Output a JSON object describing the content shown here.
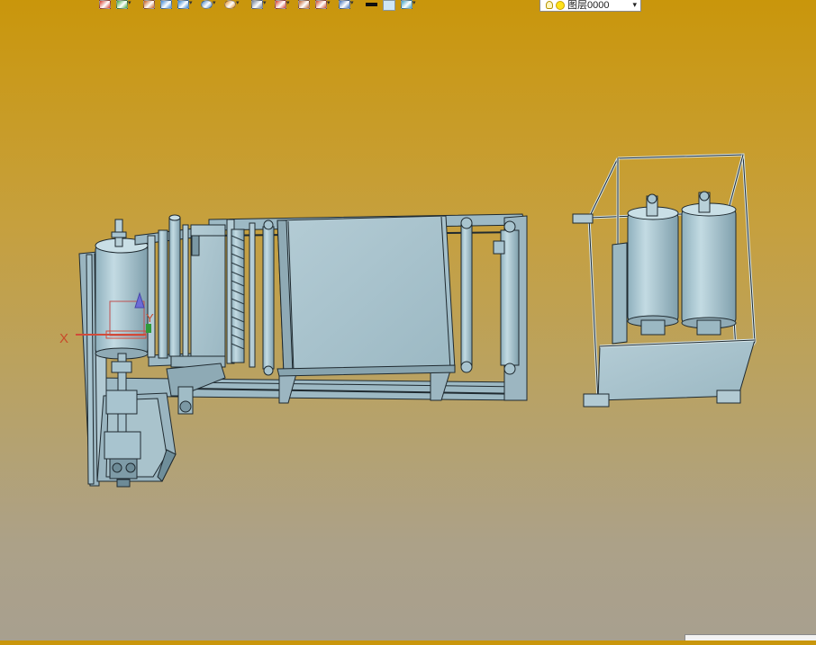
{
  "toolbar": {
    "buttons": [
      {
        "icon": "import-icon",
        "color": "#d63b2a",
        "dropdown": false
      },
      {
        "icon": "tree-icon",
        "color": "#3fa63a",
        "dropdown": true
      },
      {
        "icon": "pencil-icon",
        "color": "#c85a1a",
        "dropdown": false
      },
      {
        "icon": "layers-icon",
        "color": "#3c87d6",
        "dropdown": false
      },
      {
        "icon": "cube-icon",
        "color": "#2a7fd0",
        "dropdown": true
      },
      {
        "icon": "sphere-icon",
        "color": "#3c7fc4",
        "dropdown": true
      },
      {
        "icon": "wheel-icon",
        "color": "#e08a1c",
        "dropdown": true
      },
      {
        "icon": "sheet-icon",
        "color": "#6e7f9a",
        "dropdown": true
      },
      {
        "icon": "crosshair-icon",
        "color": "#d63b2a",
        "dropdown": true
      },
      {
        "icon": "frame-icon",
        "color": "#c0602a",
        "dropdown": false
      },
      {
        "icon": "box-select-icon",
        "color": "#d04a2a",
        "dropdown": true
      },
      {
        "icon": "display-icon",
        "color": "#3e6fb8",
        "dropdown": true
      },
      {
        "icon": "line-weight-icon",
        "color": "#111111",
        "dropdown": false
      },
      {
        "icon": "color-swatch-icon",
        "color": "#cfe6f5",
        "dropdown": false
      },
      {
        "icon": "layer-stack-icon",
        "color": "#38a1c8",
        "dropdown": true
      }
    ],
    "layer_select": {
      "value": "图层0000"
    }
  },
  "viewport": {
    "background_top": "#c9960b",
    "background_bottom": "#a8a08f",
    "model_color": "#a8c4cf",
    "model_edge_color": "#1f2a30",
    "axis": {
      "x_label": "X",
      "y_label": "Y"
    }
  }
}
